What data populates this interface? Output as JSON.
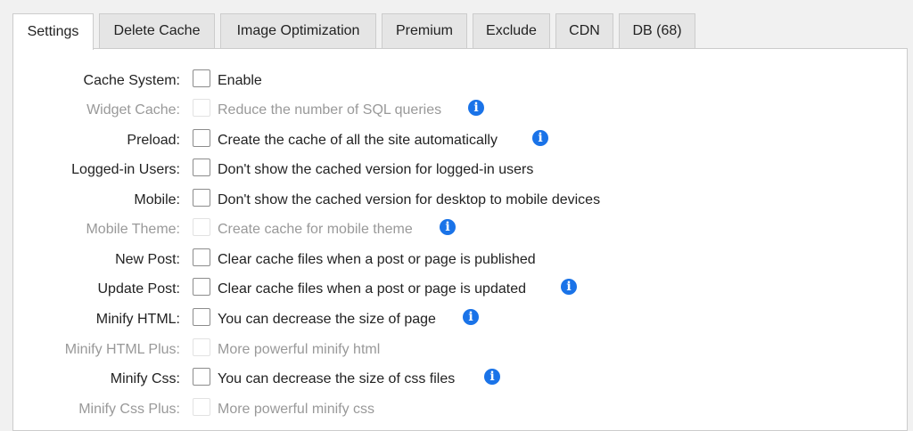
{
  "tabs": [
    {
      "label": "Settings",
      "active": true
    },
    {
      "label": "Delete Cache"
    },
    {
      "label": "Image Optimization"
    },
    {
      "label": "Premium"
    },
    {
      "label": "Exclude"
    },
    {
      "label": "CDN"
    },
    {
      "label": "DB (68)"
    }
  ],
  "settings": [
    {
      "label": "Cache System:",
      "description": "Enable",
      "enabled": true,
      "checked": false,
      "info": false
    },
    {
      "label": "Widget Cache:",
      "description": "Reduce the number of SQL queries",
      "enabled": false,
      "checked": false,
      "info": true
    },
    {
      "label": "Preload:",
      "description": "Create the cache of all the site automatically",
      "enabled": true,
      "checked": false,
      "info": true
    },
    {
      "label": "Logged-in Users:",
      "description": "Don't show the cached version for logged-in users",
      "enabled": true,
      "checked": false,
      "info": false
    },
    {
      "label": "Mobile:",
      "description": "Don't show the cached version for desktop to mobile devices",
      "enabled": true,
      "checked": false,
      "info": false
    },
    {
      "label": "Mobile Theme:",
      "description": "Create cache for mobile theme",
      "enabled": false,
      "checked": false,
      "info": true
    },
    {
      "label": "New Post:",
      "description": "Clear cache files when a post or page is published",
      "enabled": true,
      "checked": false,
      "info": false
    },
    {
      "label": "Update Post:",
      "description": "Clear cache files when a post or page is updated",
      "enabled": true,
      "checked": false,
      "info": true
    },
    {
      "label": "Minify HTML:",
      "description": "You can decrease the size of page",
      "enabled": true,
      "checked": false,
      "info": true
    },
    {
      "label": "Minify HTML Plus:",
      "description": "More powerful minify html",
      "enabled": false,
      "checked": false,
      "info": false
    },
    {
      "label": "Minify Css:",
      "description": "You can decrease the size of css files",
      "enabled": true,
      "checked": false,
      "info": true
    },
    {
      "label": "Minify Css Plus:",
      "description": "More powerful minify css",
      "enabled": false,
      "checked": false,
      "info": false
    }
  ],
  "info_icon_glyph": "i",
  "colors": {
    "info_icon": "#1a73e8",
    "disabled_text": "#999999",
    "text": "#222222"
  }
}
